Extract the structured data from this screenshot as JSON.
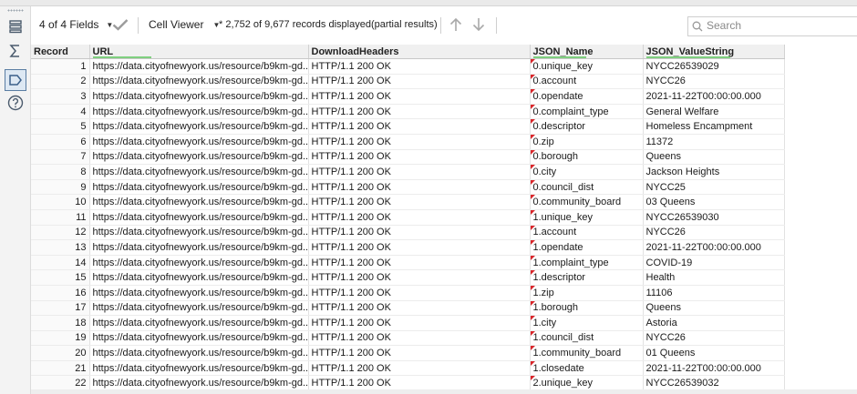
{
  "toolbar": {
    "fields_label": "4 of 4 Fields",
    "viewer_label": "Cell Viewer",
    "records_status": "* 2,752 of 9,677 records displayed(partial results)",
    "search_placeholder": "Search"
  },
  "columns": [
    "Record",
    "URL",
    "DownloadHeaders",
    "JSON_Name",
    "JSON_ValueString"
  ],
  "rows": [
    {
      "record": "1",
      "url": "https://data.cityofnewyork.us/resource/b9km-gd...",
      "headers": "HTTP/1.1 200 OK",
      "name": "0.unique_key",
      "value": "NYCC26539029"
    },
    {
      "record": "2",
      "url": "https://data.cityofnewyork.us/resource/b9km-gd...",
      "headers": "HTTP/1.1 200 OK",
      "name": "0.account",
      "value": "NYCC26"
    },
    {
      "record": "3",
      "url": "https://data.cityofnewyork.us/resource/b9km-gd...",
      "headers": "HTTP/1.1 200 OK",
      "name": "0.opendate",
      "value": "2021-11-22T00:00:00.000"
    },
    {
      "record": "4",
      "url": "https://data.cityofnewyork.us/resource/b9km-gd...",
      "headers": "HTTP/1.1 200 OK",
      "name": "0.complaint_type",
      "value": "General Welfare"
    },
    {
      "record": "5",
      "url": "https://data.cityofnewyork.us/resource/b9km-gd...",
      "headers": "HTTP/1.1 200 OK",
      "name": "0.descriptor",
      "value": "Homeless Encampment"
    },
    {
      "record": "6",
      "url": "https://data.cityofnewyork.us/resource/b9km-gd...",
      "headers": "HTTP/1.1 200 OK",
      "name": "0.zip",
      "value": "11372"
    },
    {
      "record": "7",
      "url": "https://data.cityofnewyork.us/resource/b9km-gd...",
      "headers": "HTTP/1.1 200 OK",
      "name": "0.borough",
      "value": "Queens"
    },
    {
      "record": "8",
      "url": "https://data.cityofnewyork.us/resource/b9km-gd...",
      "headers": "HTTP/1.1 200 OK",
      "name": "0.city",
      "value": "Jackson Heights"
    },
    {
      "record": "9",
      "url": "https://data.cityofnewyork.us/resource/b9km-gd...",
      "headers": "HTTP/1.1 200 OK",
      "name": "0.council_dist",
      "value": "NYCC25"
    },
    {
      "record": "10",
      "url": "https://data.cityofnewyork.us/resource/b9km-gd...",
      "headers": "HTTP/1.1 200 OK",
      "name": "0.community_board",
      "value": "03 Queens"
    },
    {
      "record": "11",
      "url": "https://data.cityofnewyork.us/resource/b9km-gd...",
      "headers": "HTTP/1.1 200 OK",
      "name": "1.unique_key",
      "value": "NYCC26539030"
    },
    {
      "record": "12",
      "url": "https://data.cityofnewyork.us/resource/b9km-gd...",
      "headers": "HTTP/1.1 200 OK",
      "name": "1.account",
      "value": "NYCC26"
    },
    {
      "record": "13",
      "url": "https://data.cityofnewyork.us/resource/b9km-gd...",
      "headers": "HTTP/1.1 200 OK",
      "name": "1.opendate",
      "value": "2021-11-22T00:00:00.000"
    },
    {
      "record": "14",
      "url": "https://data.cityofnewyork.us/resource/b9km-gd...",
      "headers": "HTTP/1.1 200 OK",
      "name": "1.complaint_type",
      "value": "COVID-19"
    },
    {
      "record": "15",
      "url": "https://data.cityofnewyork.us/resource/b9km-gd...",
      "headers": "HTTP/1.1 200 OK",
      "name": "1.descriptor",
      "value": "Health"
    },
    {
      "record": "16",
      "url": "https://data.cityofnewyork.us/resource/b9km-gd...",
      "headers": "HTTP/1.1 200 OK",
      "name": "1.zip",
      "value": "11106"
    },
    {
      "record": "17",
      "url": "https://data.cityofnewyork.us/resource/b9km-gd...",
      "headers": "HTTP/1.1 200 OK",
      "name": "1.borough",
      "value": "Queens"
    },
    {
      "record": "18",
      "url": "https://data.cityofnewyork.us/resource/b9km-gd...",
      "headers": "HTTP/1.1 200 OK",
      "name": "1.city",
      "value": "Astoria"
    },
    {
      "record": "19",
      "url": "https://data.cityofnewyork.us/resource/b9km-gd...",
      "headers": "HTTP/1.1 200 OK",
      "name": "1.council_dist",
      "value": "NYCC26"
    },
    {
      "record": "20",
      "url": "https://data.cityofnewyork.us/resource/b9km-gd...",
      "headers": "HTTP/1.1 200 OK",
      "name": "1.community_board",
      "value": "01 Queens"
    },
    {
      "record": "21",
      "url": "https://data.cityofnewyork.us/resource/b9km-gd...",
      "headers": "HTTP/1.1 200 OK",
      "name": "1.closedate",
      "value": "2021-11-22T00:00:00.000"
    },
    {
      "record": "22",
      "url": "https://data.cityofnewyork.us/resource/b9km-gd...",
      "headers": "HTTP/1.1 200 OK",
      "name": "2.unique_key",
      "value": "NYCC26539032"
    }
  ]
}
